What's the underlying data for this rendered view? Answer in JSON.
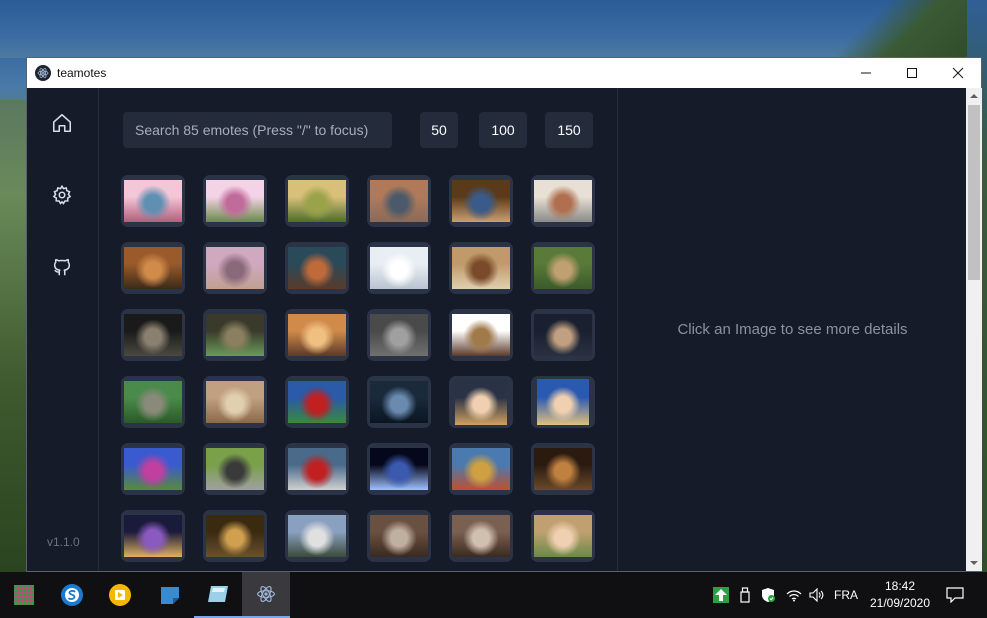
{
  "window": {
    "title": "teamotes",
    "minimize_icon": "minimize-icon",
    "maximize_icon": "maximize-icon",
    "close_icon": "close-icon"
  },
  "sidebar": {
    "items": [
      {
        "name": "home",
        "icon": "home-icon"
      },
      {
        "name": "settings",
        "icon": "gear-icon"
      },
      {
        "name": "github",
        "icon": "github-icon"
      }
    ],
    "version": "v1.1.0"
  },
  "toolbar": {
    "search_placeholder": "Search 85 emotes (Press \"/\" to focus)",
    "sizes": [
      "50",
      "100",
      "150"
    ]
  },
  "emotes": [
    {
      "subject": "pink blossom lake",
      "colors": [
        "#f3c6d8",
        "#5f8fb2",
        "#b1607c"
      ]
    },
    {
      "subject": "pink daisy flowers",
      "colors": [
        "#f4d3e6",
        "#c06b9a",
        "#6a8a4a"
      ]
    },
    {
      "subject": "green field sunset",
      "colors": [
        "#d9c07a",
        "#9aa24a",
        "#4d6d2a"
      ]
    },
    {
      "subject": "mountain lake reflection",
      "colors": [
        "#b07a5a",
        "#4b5a6a",
        "#8a6a5a"
      ]
    },
    {
      "subject": "blue jay bird",
      "colors": [
        "#5a3a1a",
        "#3a5a8a",
        "#c7a070"
      ]
    },
    {
      "subject": "train",
      "colors": [
        "#e8e0d4",
        "#b07050",
        "#8a8a8a"
      ]
    },
    {
      "subject": "tabby cat face",
      "colors": [
        "#9a5a2a",
        "#d08a4a",
        "#3a2a1a"
      ]
    },
    {
      "subject": "canyon sunset",
      "colors": [
        "#d0a8c0",
        "#8a6a7a",
        "#c0a090"
      ]
    },
    {
      "subject": "rocky coast",
      "colors": [
        "#2a4a5a",
        "#c06a3a",
        "#5a3a2a"
      ]
    },
    {
      "subject": "white cat blue eyes",
      "colors": [
        "#e8eef4",
        "#ffffff",
        "#b8c4d0"
      ]
    },
    {
      "subject": "kitten on books",
      "colors": [
        "#c09a6a",
        "#7a4a2a",
        "#e0d0b0"
      ]
    },
    {
      "subject": "cat in grass",
      "colors": [
        "#5a7a3a",
        "#c0a070",
        "#3a5a2a"
      ]
    },
    {
      "subject": "grey tabby cat",
      "colors": [
        "#1a1a1a",
        "#8a8070",
        "#4a4a40"
      ]
    },
    {
      "subject": "tabby green eyes",
      "colors": [
        "#3a3a2a",
        "#8a8060",
        "#6a9a5a"
      ]
    },
    {
      "subject": "orange cat",
      "colors": [
        "#d08a4a",
        "#f0c080",
        "#5a3a2a"
      ]
    },
    {
      "subject": "grey british cat",
      "colors": [
        "#4a4a4a",
        "#a0a0a0",
        "#707070"
      ]
    },
    {
      "subject": "two rabbits",
      "colors": [
        "#ffffff",
        "#a07a4a",
        "#5a3a2a"
      ]
    },
    {
      "subject": "kitten",
      "colors": [
        "#1a2030",
        "#c0a080",
        "#2a3040"
      ]
    },
    {
      "subject": "cat in garden",
      "colors": [
        "#4a8a4a",
        "#8a8a7a",
        "#2a5a2a"
      ]
    },
    {
      "subject": "running horses",
      "colors": [
        "#c0a080",
        "#e0d0b0",
        "#8a6a4a"
      ]
    },
    {
      "subject": "red poppies",
      "colors": [
        "#2a5aa8",
        "#c02020",
        "#3a8a3a"
      ]
    },
    {
      "subject": "eye close-up",
      "colors": [
        "#1a2a3a",
        "#6a8ab0",
        "#0a1520"
      ]
    },
    {
      "subject": "portrait woman blonde",
      "colors": [
        "#2a3246",
        "#f0d0b0",
        "#d0a060"
      ]
    },
    {
      "subject": "portrait woman blue background",
      "colors": [
        "#2a5ab0",
        "#f0d0b0",
        "#e0c080"
      ]
    },
    {
      "subject": "purple flowers",
      "colors": [
        "#3a5ad0",
        "#c040a0",
        "#5a8a3a"
      ]
    },
    {
      "subject": "classic car street",
      "colors": [
        "#7aa04a",
        "#3a3a3a",
        "#a0a0a0"
      ]
    },
    {
      "subject": "red mustang",
      "colors": [
        "#4a6a8a",
        "#c02020",
        "#d0d0d0"
      ]
    },
    {
      "subject": "space tunnel",
      "colors": [
        "#05081a",
        "#3a5ab0",
        "#a0c0ff"
      ]
    },
    {
      "subject": "colorful harbor town",
      "colors": [
        "#4a7ab0",
        "#d0a040",
        "#c05030"
      ]
    },
    {
      "subject": "living room interior",
      "colors": [
        "#2a1a10",
        "#c08040",
        "#6a4a2a"
      ]
    },
    {
      "subject": "night street lights",
      "colors": [
        "#1a1a3a",
        "#8a5ac0",
        "#e0b060"
      ]
    },
    {
      "subject": "corridor arches",
      "colors": [
        "#3a2a10",
        "#d0a050",
        "#6a5030"
      ]
    },
    {
      "subject": "beach palm trees",
      "colors": [
        "#8aa0c0",
        "#e0e0e0",
        "#3a4a3a"
      ]
    },
    {
      "subject": "wine barrels",
      "colors": [
        "#6a5040",
        "#c0b0a0",
        "#3a2a20"
      ]
    },
    {
      "subject": "wine cellar",
      "colors": [
        "#7a6050",
        "#d0c0b0",
        "#3a2a20"
      ]
    },
    {
      "subject": "family picnic",
      "colors": [
        "#c0a070",
        "#f0d0b0",
        "#6a8a4a"
      ]
    }
  ],
  "details": {
    "placeholder": "Click an Image to see more details"
  },
  "taskbar": {
    "apps": [
      {
        "name": "tiled-app",
        "icon": "grid-icon"
      },
      {
        "name": "s-app",
        "icon": "s-circle-icon"
      },
      {
        "name": "media-app",
        "icon": "play-circle-icon"
      },
      {
        "name": "notes-app",
        "icon": "sticky-note-icon"
      },
      {
        "name": "glass-app",
        "icon": "glass-panel-icon"
      },
      {
        "name": "teamotes",
        "icon": "electron-icon"
      }
    ],
    "language": "FRA",
    "time": "18:42",
    "date": "21/09/2020"
  }
}
